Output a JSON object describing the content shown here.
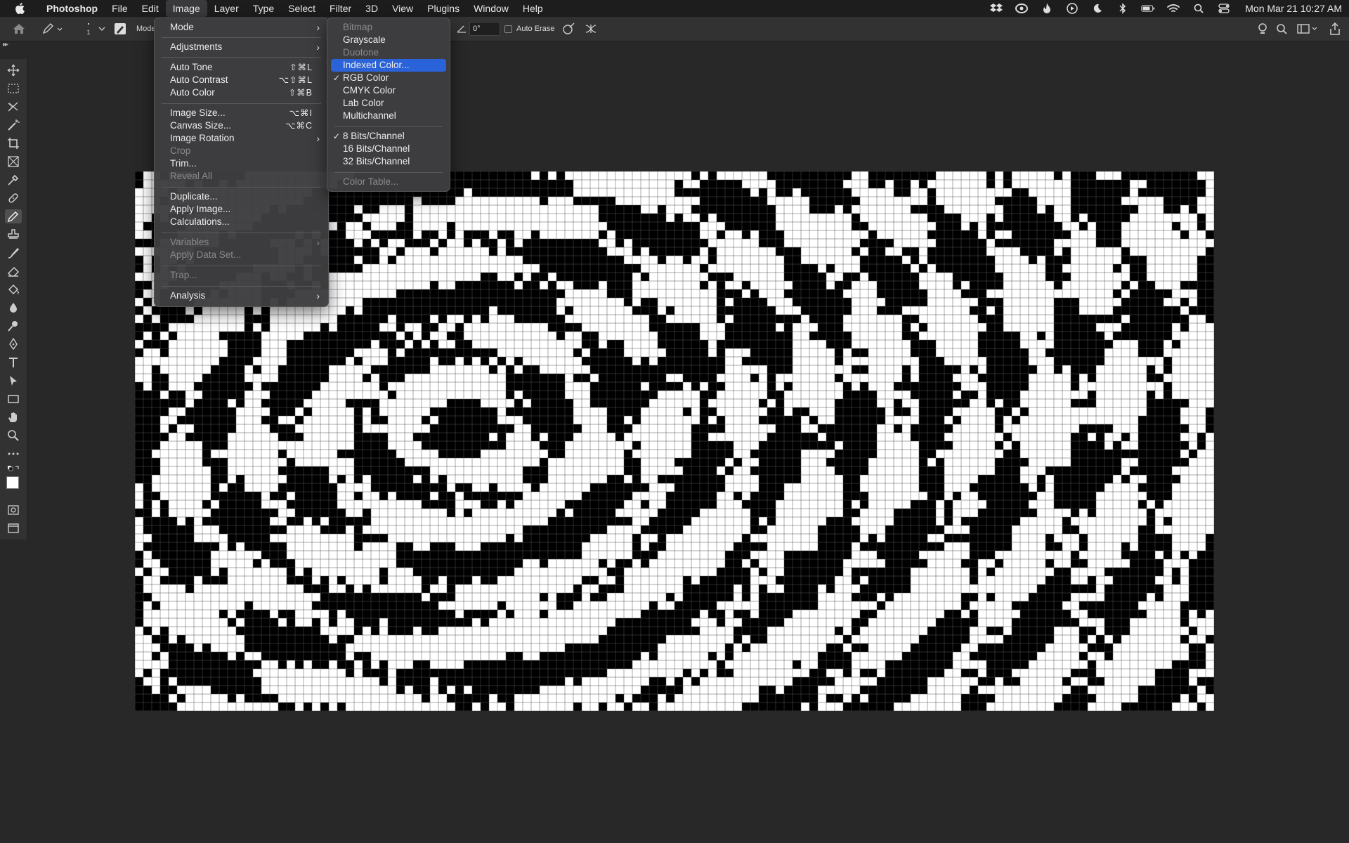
{
  "menubar": {
    "app": "Photoshop",
    "items": [
      "File",
      "Edit",
      "Image",
      "Layer",
      "Type",
      "Select",
      "Filter",
      "3D",
      "View",
      "Plugins",
      "Window",
      "Help"
    ],
    "clock": "Mon Mar 21  10:27 AM"
  },
  "options": {
    "mode_label": "Mode",
    "brush_size": "1",
    "angle": "0°",
    "auto_erase": "Auto Erase"
  },
  "image_menu": {
    "mode": "Mode",
    "adjustments": "Adjustments",
    "auto_tone": "Auto Tone",
    "auto_tone_sc": "⇧⌘L",
    "auto_contrast": "Auto Contrast",
    "auto_contrast_sc": "⌥⇧⌘L",
    "auto_color": "Auto Color",
    "auto_color_sc": "⇧⌘B",
    "image_size": "Image Size...",
    "image_size_sc": "⌥⌘I",
    "canvas_size": "Canvas Size...",
    "canvas_size_sc": "⌥⌘C",
    "image_rotation": "Image Rotation",
    "crop": "Crop",
    "trim": "Trim...",
    "reveal_all": "Reveal All",
    "duplicate": "Duplicate...",
    "apply_image": "Apply Image...",
    "calculations": "Calculations...",
    "variables": "Variables",
    "apply_data_set": "Apply Data Set...",
    "trap": "Trap...",
    "analysis": "Analysis"
  },
  "mode_menu": {
    "bitmap": "Bitmap",
    "grayscale": "Grayscale",
    "duotone": "Duotone",
    "indexed": "Indexed Color...",
    "rgb": "RGB Color",
    "cmyk": "CMYK Color",
    "lab": "Lab Color",
    "multichannel": "Multichannel",
    "bits8": "8 Bits/Channel",
    "bits16": "16 Bits/Channel",
    "bits32": "32 Bits/Channel",
    "color_table": "Color Table..."
  },
  "colors": {
    "highlight": "#2a62d9",
    "menu_bg": "#3e3e40",
    "app_bg": "#282828"
  }
}
